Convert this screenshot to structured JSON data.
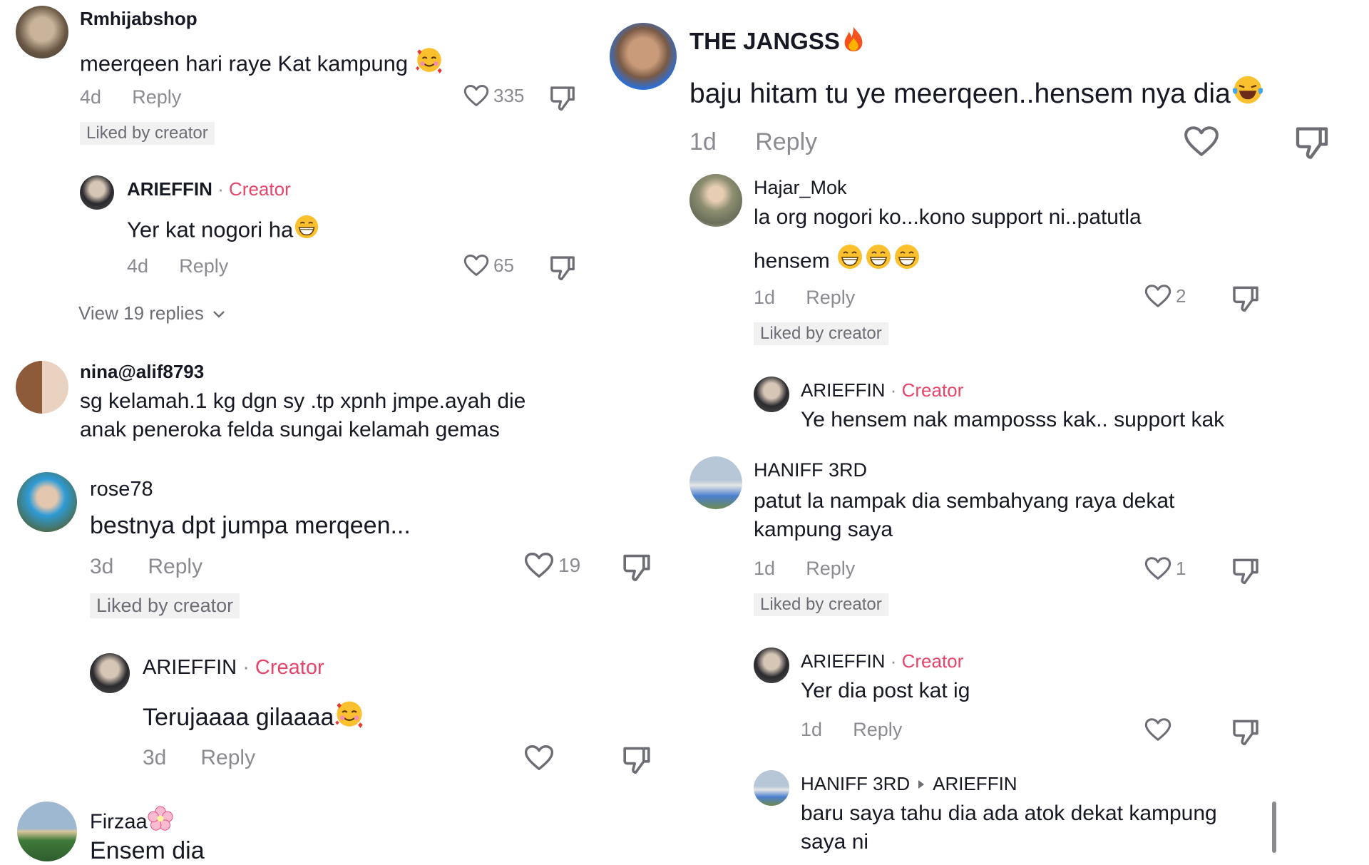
{
  "colors": {
    "creator": "#e6456a",
    "muted": "#8a8b91",
    "badge_bg": "#f1f1f2"
  },
  "icons": {
    "like": "heart-outline-icon",
    "dislike": "thumbs-down-icon",
    "chevron": "chevron-down-icon"
  },
  "panel1": {
    "comment": {
      "username": "Rmhijabshop",
      "text": "meerqeen hari raye Kat kampung",
      "emoji": "smiling-face-with-hearts",
      "age": "4d",
      "reply_label": "Reply",
      "likes": "335",
      "badge": "Liked by creator"
    },
    "reply": {
      "username": "ARIEFFIN",
      "sep": "·",
      "creator_tag": "Creator",
      "text": "Yer kat nogori ha",
      "emoji": "grinning-face",
      "age": "4d",
      "reply_label": "Reply",
      "likes": "65"
    },
    "view_replies": "View 19 replies"
  },
  "panel2": {
    "comment": {
      "username": "nina@alif8793",
      "line1": "sg kelamah.1 kg dgn sy .tp xpnh jmpe.ayah die",
      "line2": "anak peneroka felda sungai kelamah gemas"
    }
  },
  "panel3": {
    "comment": {
      "username": "rose78",
      "text": "bestnya dpt jumpa merqeen...",
      "age": "3d",
      "reply_label": "Reply",
      "likes": "19",
      "badge": "Liked by creator"
    },
    "reply": {
      "username": "ARIEFFIN",
      "sep": "·",
      "creator_tag": "Creator",
      "text": "Terujaaaa gilaaaa",
      "emoji": "smiling-face-with-hearts",
      "age": "3d",
      "reply_label": "Reply"
    },
    "comment2": {
      "username": "Firzaa",
      "emoji": "cherry-blossom",
      "text": "Ensem dia"
    }
  },
  "panel4": {
    "comment": {
      "username": "THE JANGSS",
      "emoji": "fire",
      "text": "baju hitam tu ye meerqeen..hensem nya dia",
      "text_emoji": "face-with-tears-of-joy",
      "age": "1d",
      "reply_label": "Reply"
    }
  },
  "panel5": {
    "comment1": {
      "username": "Hajar_Mok",
      "line1": "la org nogori ko...kono support ni..patutla",
      "line2": "hensem",
      "emoji": "grinning-face",
      "age": "1d",
      "reply_label": "Reply",
      "likes": "2",
      "badge": "Liked by creator"
    },
    "reply1": {
      "username": "ARIEFFIN",
      "sep": "·",
      "creator_tag": "Creator",
      "text": "Ye hensem nak mamposss kak.. support kak"
    },
    "comment2": {
      "username": "HANIFF 3RD",
      "line1": "patut la nampak dia sembahyang raya dekat",
      "line2": "kampung saya",
      "age": "1d",
      "reply_label": "Reply",
      "likes": "1",
      "badge": "Liked by creator"
    },
    "reply2": {
      "username": "ARIEFFIN",
      "sep": "·",
      "creator_tag": "Creator",
      "text": "Yer dia post kat ig",
      "age": "1d",
      "reply_label": "Reply"
    },
    "reply3": {
      "username": "HANIFF 3RD",
      "target": "ARIEFFIN",
      "line1": "baru saya tahu dia ada atok dekat kampung",
      "line2": "saya ni"
    }
  }
}
